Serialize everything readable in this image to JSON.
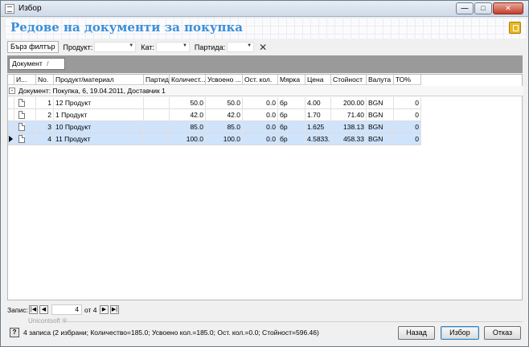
{
  "window": {
    "title": "Избор",
    "min_label": "—",
    "max_label": "□",
    "close_label": "✕"
  },
  "header": {
    "title": "Редове на документи за покупка"
  },
  "filterbar": {
    "quick_filter": "Бърз филтър",
    "product_label": "Продукт:",
    "product_value": "",
    "cat_label": "Кат:",
    "cat_value": "",
    "batch_label": "Партида:",
    "batch_value": ""
  },
  "groupbar": {
    "chip_label": "Документ",
    "chip_sort": "/"
  },
  "grid": {
    "columns": [
      "И...",
      "No.",
      "Продукт/материал",
      "Партида",
      "Количест...",
      "Усвоено ...",
      "Ост. кол.",
      "Мярка",
      "Цена",
      "Стойност",
      "Валута",
      "ТО%"
    ],
    "group_label": "Документ: Покупка, 6, 19.04.2011, Доставчик 1",
    "expander": "-",
    "rows": [
      {
        "no": "1",
        "product": "12 Продукт",
        "batch": "",
        "qty": "50.0",
        "used": "50.0",
        "rest": "0.0",
        "unit": "бр",
        "price": "4.00",
        "value": "200.00",
        "currency": "BGN",
        "to": "0"
      },
      {
        "no": "2",
        "product": "1 Продукт",
        "batch": "",
        "qty": "42.0",
        "used": "42.0",
        "rest": "0.0",
        "unit": "бр",
        "price": "1.70",
        "value": "71.40",
        "currency": "BGN",
        "to": "0"
      },
      {
        "no": "3",
        "product": "10 Продукт",
        "batch": "",
        "qty": "85.0",
        "used": "85.0",
        "rest": "0.0",
        "unit": "бр",
        "price": "1.625",
        "value": "138.13",
        "currency": "BGN",
        "to": "0"
      },
      {
        "no": "4",
        "product": "11 Продукт",
        "batch": "",
        "qty": "100.0",
        "used": "100.0",
        "rest": "0.0",
        "unit": "бр",
        "price": "4.5833...",
        "value": "458.33",
        "currency": "BGN",
        "to": "0"
      }
    ]
  },
  "navigator": {
    "label": "Запис:",
    "current": "4",
    "of_text": "от 4"
  },
  "brand": {
    "text": "Unicontsoft ®"
  },
  "status": {
    "text": "4 записа (2 избрани; Количество=185.0; Усвоено кол.=185.0; Ост. кол.=0.0; Стойност=596.46)",
    "back": "Назад",
    "select": "Избор",
    "cancel": "Отказ"
  },
  "colors": {
    "title_blue": "#3b8fd9",
    "selection": "#cfe3fb"
  }
}
